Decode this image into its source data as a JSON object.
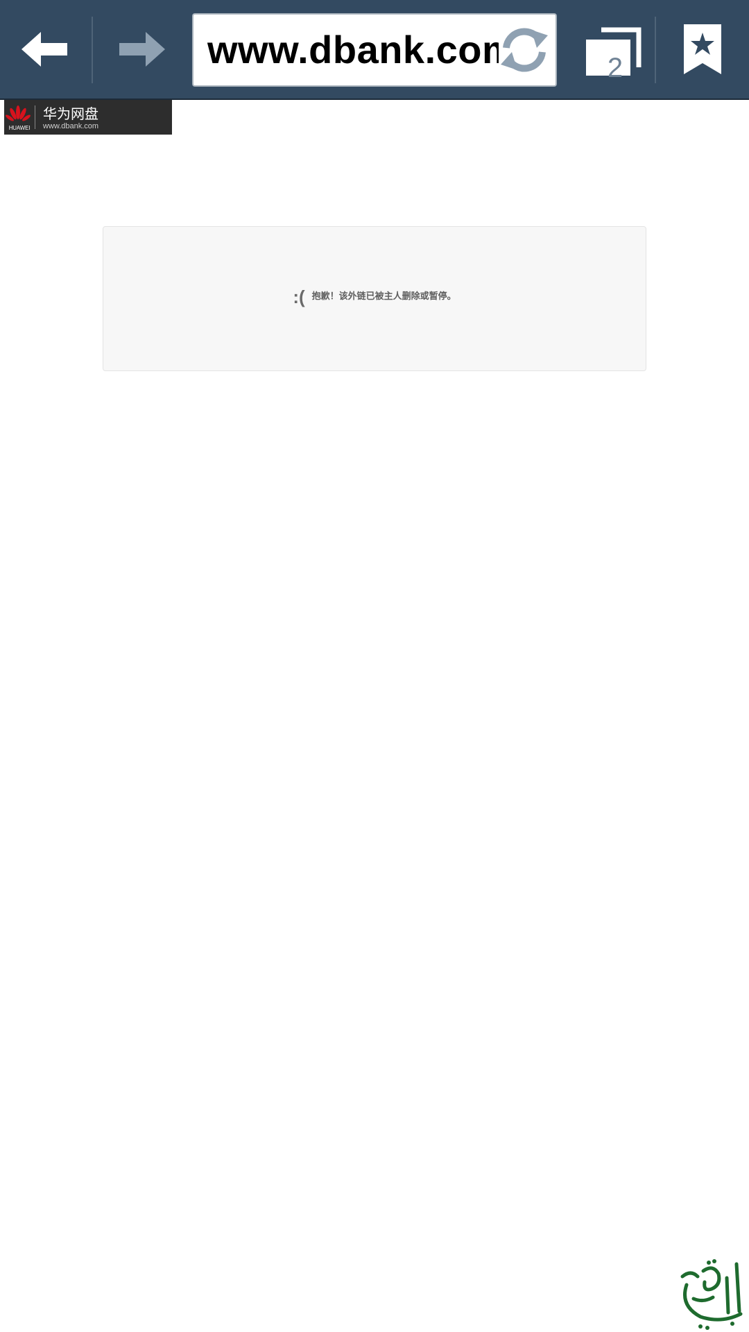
{
  "toolbar": {
    "url": "www.dbank.com",
    "tab_count": "2"
  },
  "banner": {
    "brand": "HUAWEI",
    "name": "华为网盘",
    "url": "www.dbank.com"
  },
  "notice": {
    "face": ":(",
    "message": "抱歉！该外链已被主人删除或暂停。"
  },
  "icons": {
    "back": "arrow-left-icon",
    "forward": "arrow-right-icon",
    "refresh": "refresh-icon",
    "tabs": "tabs-icon",
    "bookmark": "bookmark-star-icon",
    "logo": "huawei-logo-icon",
    "watermark": "arabic-calligraphy-watermark"
  },
  "colors": {
    "toolbar_bg": "#334a61",
    "forward_disabled": "#8fa1b2",
    "logo_red": "#d7121d",
    "watermark_green": "#1e6b2e"
  }
}
